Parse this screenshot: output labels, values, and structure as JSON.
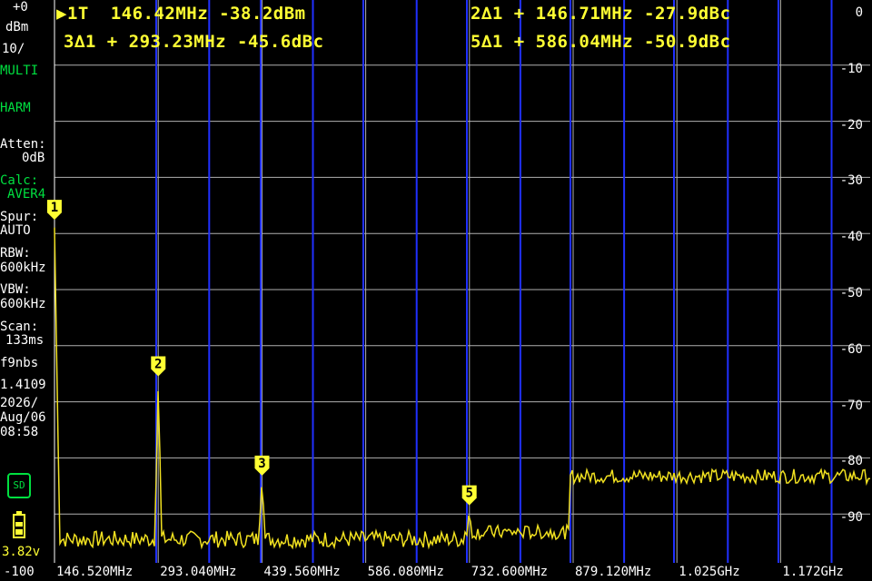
{
  "marker_readouts": [
    {
      "text": "▶1T  146.42MHz -38.2dBm"
    },
    {
      "text": "2∆1 + 146.71MHz -27.9dBc"
    },
    {
      "text": "3∆1 + 293.23MHz -45.6dBc"
    },
    {
      "text": "5∆1 + 586.04MHz -50.9dBc"
    }
  ],
  "sidebar": {
    "ref_level": "+0",
    "unit": "dBm",
    "scale": "10/",
    "mode": "MULTI",
    "harm": "HARM",
    "atten_label": "Atten:",
    "atten_value": "0dB",
    "calc_label": "Calc:",
    "calc_value": "AVER4",
    "spur_label": "Spur:",
    "spur_value": "AUTO",
    "rbw_label": "RBW:",
    "rbw_value": "600kHz",
    "vbw_label": "VBW:",
    "vbw_value": "600kHz",
    "scan_label": "Scan:",
    "scan_value": "133ms",
    "fw_label": "f9nbs",
    "fw_value": "1.4109",
    "date": "2026/",
    "date2": "Aug/06",
    "time": "08:58",
    "sd_label": "SD",
    "battery_voltage": "3.82v",
    "bottom_level": "-100"
  },
  "y_ticks": [
    "0",
    "-10",
    "-20",
    "-30",
    "-40",
    "-50",
    "-60",
    "-70",
    "-80",
    "-90"
  ],
  "x_ticks": [
    "146.520MHz",
    "293.040MHz",
    "439.560MHz",
    "586.080MHz",
    "732.600MHz",
    "879.120MHz",
    "1.025GHz",
    "1.172GHz"
  ],
  "markers": [
    {
      "label": "1",
      "freq_mhz": 146.42,
      "level_dbm": -38.2
    },
    {
      "label": "2",
      "freq_mhz": 293.13,
      "level_dbm": -66.1
    },
    {
      "label": "3",
      "freq_mhz": 439.65,
      "level_dbm": -83.8
    },
    {
      "label": "5",
      "freq_mhz": 732.46,
      "level_dbm": -89.1
    }
  ],
  "colors": {
    "trace": "#f0e020",
    "marker": "#ffff33",
    "grid_white": "#b0b0b0",
    "grid_blue": "#2030ff",
    "green_text": "#00e040"
  }
}
